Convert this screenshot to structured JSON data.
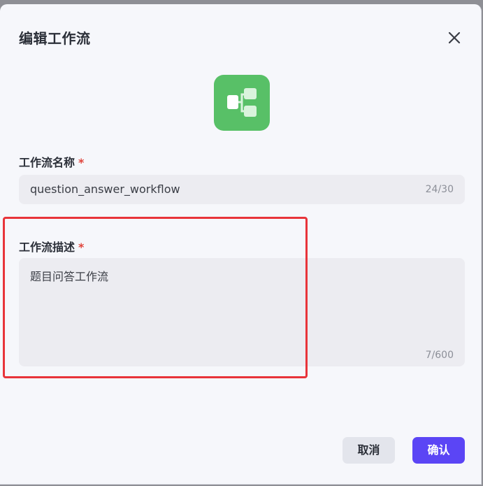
{
  "dialog": {
    "title": "编辑工作流",
    "close_icon": "close-icon"
  },
  "workflow_icon": {
    "icon": "workflow-branch-icon",
    "background": "#58c067"
  },
  "name_field": {
    "label": "工作流名称",
    "required_mark": "*",
    "value": "question_answer_workflow",
    "counter": "24/30"
  },
  "description_field": {
    "label": "工作流描述",
    "required_mark": "*",
    "value": "题目问答工作流",
    "counter": "7/600"
  },
  "highlight_color": "#e8343a",
  "actions": {
    "cancel_label": "取消",
    "confirm_label": "确认",
    "confirm_color": "#5b45f5"
  }
}
